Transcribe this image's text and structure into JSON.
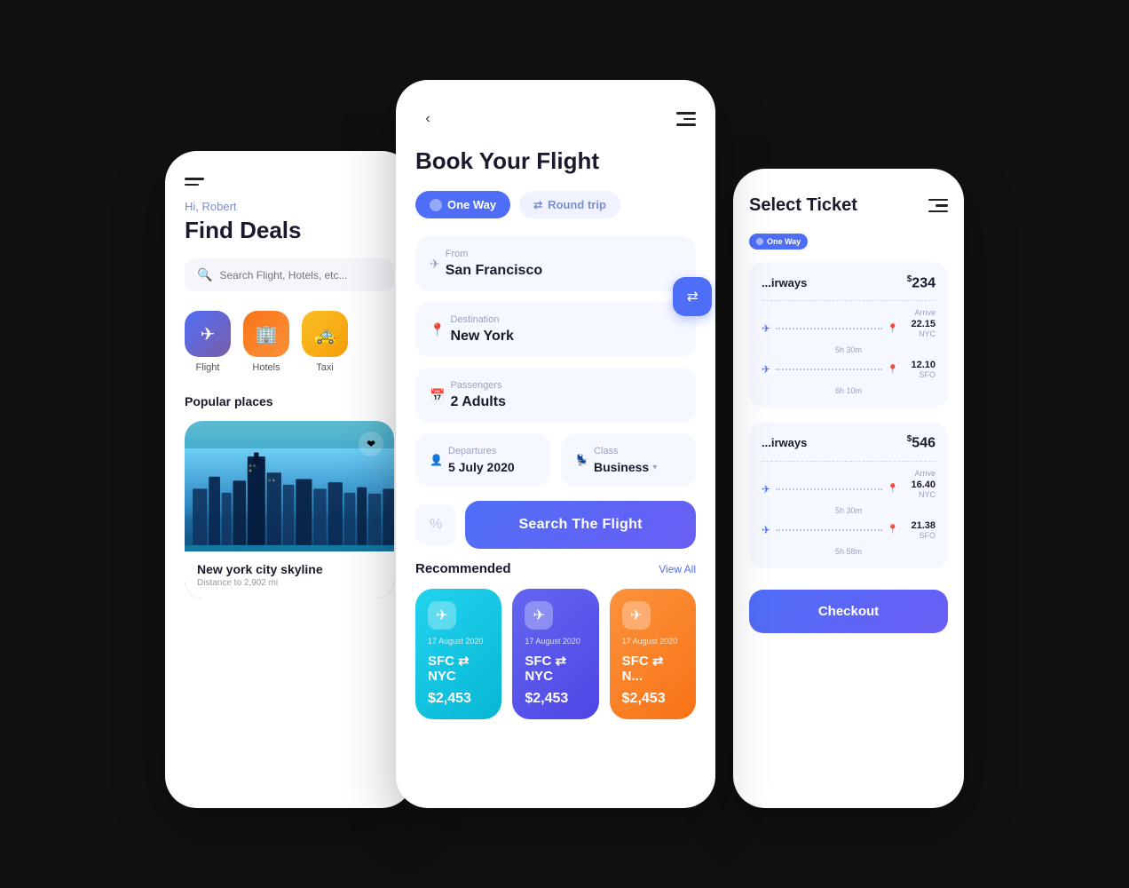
{
  "left": {
    "menu_icon": "☰",
    "greeting": "Hi, Robert",
    "title": "Find Deals",
    "search_placeholder": "Search Flight, Hotels, etc...",
    "categories": [
      {
        "id": "flight",
        "icon": "✈",
        "label": "Flight",
        "color_class": "cat-flight"
      },
      {
        "id": "hotels",
        "icon": "🏨",
        "label": "Hotels",
        "color_class": "cat-hotel"
      },
      {
        "id": "taxi",
        "icon": "🚕",
        "label": "Taxi",
        "color_class": "cat-taxi"
      }
    ],
    "popular_label": "Popular places",
    "place_name": "New york city skyline",
    "place_distance": "Distance to 2,902 mi"
  },
  "center": {
    "back_label": "‹",
    "menu_icon": "≡",
    "title": "Book Your Flight",
    "trip_one_way": "One Way",
    "trip_round": "Round trip",
    "from_label": "From",
    "from_value": "San Francisco",
    "dest_label": "Destination",
    "dest_value": "New York",
    "pass_label": "Passengers",
    "pass_value": "2 Adults",
    "dep_label": "Departures",
    "dep_value": "5 July 2020",
    "class_label": "Class",
    "class_value": "Business",
    "search_btn": "Search The Flight",
    "recommend_label": "Recommended",
    "view_all": "View All",
    "rec_cards": [
      {
        "date": "17 August 2020",
        "route": "SFC ⇄ NYC",
        "price": "$2,453",
        "color": "rec-card-blue"
      },
      {
        "date": "17 August 2020",
        "route": "SFC ⇄ NYC",
        "price": "$2,453",
        "color": "rec-card-indigo"
      },
      {
        "date": "17 August 2020",
        "route": "SFC ⇄ N...",
        "price": "$2,453",
        "color": "rec-card-orange"
      }
    ]
  },
  "right": {
    "title": "Select Ticket",
    "menu_icon": "≡",
    "badge": "One Way",
    "airlines": [
      {
        "name": "...irways",
        "price": "234",
        "flights": [
          {
            "duration": "5h 30m",
            "arrive_label": "Arrive",
            "time": "22.15",
            "code": "NYC"
          },
          {
            "duration": "6h 10m",
            "arrive_label": "",
            "time": "12.10",
            "code": "SFO"
          }
        ]
      },
      {
        "name": "...irways",
        "price": "546",
        "flights": [
          {
            "duration": "5h 30m",
            "arrive_label": "Arrive",
            "time": "16.40",
            "code": "NYC"
          },
          {
            "duration": "5h 58m",
            "arrive_label": "",
            "time": "21.38",
            "code": "SFO"
          }
        ]
      }
    ],
    "checkout_btn": "Checkout"
  }
}
